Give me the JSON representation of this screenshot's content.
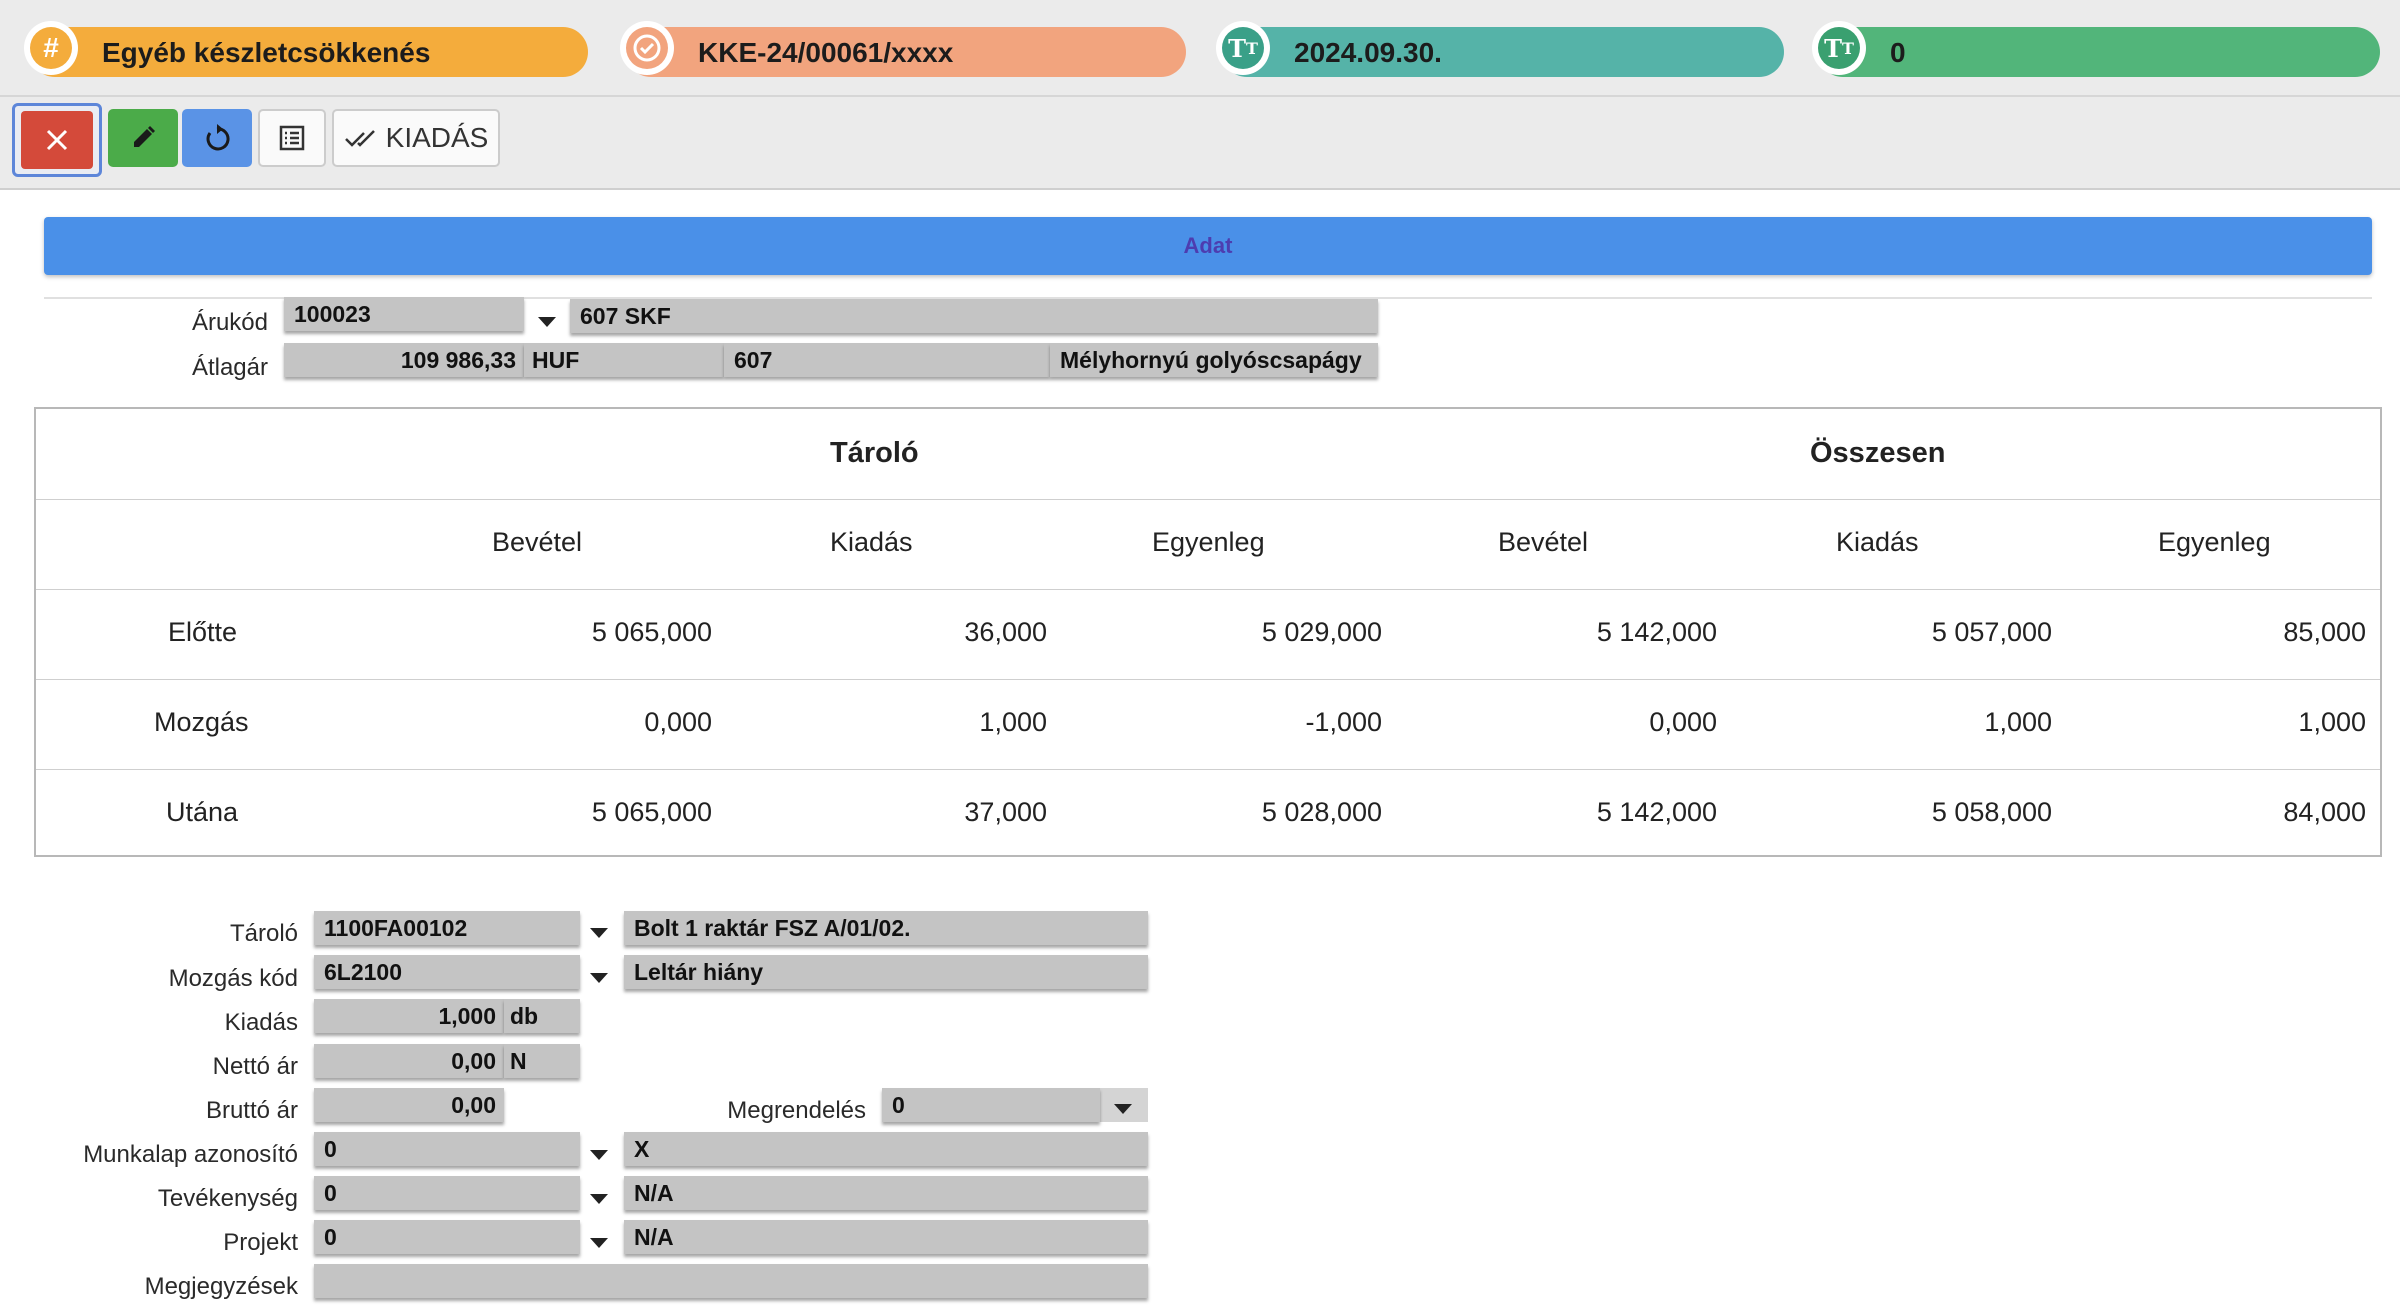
{
  "header_pills": [
    {
      "text": "Egyéb készletcsökkenés",
      "icon": "hash-icon",
      "color": "#f4ac3c",
      "circle_color": "#f4ac3c"
    },
    {
      "text": "KKE-24/00061/xxxx",
      "icon": "check-badge-icon",
      "color": "#f2a47e",
      "circle_color": "#f2a47e"
    },
    {
      "text": "2024.09.30.",
      "icon": "text-size-icon",
      "color": "#55b3a8",
      "circle_color": "#3aa088"
    },
    {
      "text": "0",
      "icon": "text-size-icon",
      "color": "#52b57a",
      "circle_color": "#3aa070"
    }
  ],
  "toolbar": {
    "close_icon": "close-icon",
    "edit_icon": "pencil-icon",
    "refresh_icon": "refresh-icon",
    "list_icon": "list-icon",
    "kiadas_label": "KIADÁS",
    "kiadas_icon": "double-check-icon"
  },
  "section_title": "Adat",
  "item": {
    "arukod_label": "Árukód",
    "arukod_value": "100023",
    "arukod_desc": "607 SKF",
    "atlagar_label": "Átlagár",
    "atlagar_value": "109 986,33",
    "atlagar_currency": "HUF",
    "atlagar_code": "607",
    "atlagar_name": "Mélyhornyú golyóscsapágy"
  },
  "stock_table": {
    "group_headers": [
      "Tároló",
      "Összesen"
    ],
    "columns": [
      "Bevétel",
      "Kiadás",
      "Egyenleg",
      "Bevétel",
      "Kiadás",
      "Egyenleg"
    ],
    "rows": [
      {
        "label": "Előtte",
        "values": [
          "5 065,000",
          "36,000",
          "5 029,000",
          "5 142,000",
          "5 057,000",
          "85,000"
        ]
      },
      {
        "label": "Mozgás",
        "values": [
          "0,000",
          "1,000",
          "-1,000",
          "0,000",
          "1,000",
          "1,000"
        ]
      },
      {
        "label": "Utána",
        "values": [
          "5 065,000",
          "37,000",
          "5 028,000",
          "5 142,000",
          "5 058,000",
          "84,000"
        ]
      }
    ]
  },
  "form": {
    "tarolo_label": "Tároló",
    "tarolo_value": "1100FA00102",
    "tarolo_desc": "Bolt 1 raktár FSZ  A/01/02.",
    "mozgas_label": "Mozgás kód",
    "mozgas_value": "6L2100",
    "mozgas_desc": "Leltár hiány",
    "kiadas_label": "Kiadás",
    "kiadas_value": "1,000",
    "kiadas_unit": "db",
    "netto_label": "Nettó ár",
    "netto_value": "0,00",
    "netto_unit": "N",
    "brutto_label": "Bruttó ár",
    "brutto_value": "0,00",
    "megrendeles_label": "Megrendelés",
    "megrendeles_value": "0",
    "munkalap_label": "Munkalap azonosító",
    "munkalap_value": "0",
    "munkalap_desc": "X",
    "tevekenyseg_label": "Tevékenység",
    "tevekenyseg_value": "0",
    "tevekenyseg_desc": "N/A",
    "projekt_label": "Projekt",
    "projekt_value": "0",
    "projekt_desc": "N/A",
    "megjegyzesek_label": "Megjegyzések",
    "megjegyzesek_value": ""
  }
}
